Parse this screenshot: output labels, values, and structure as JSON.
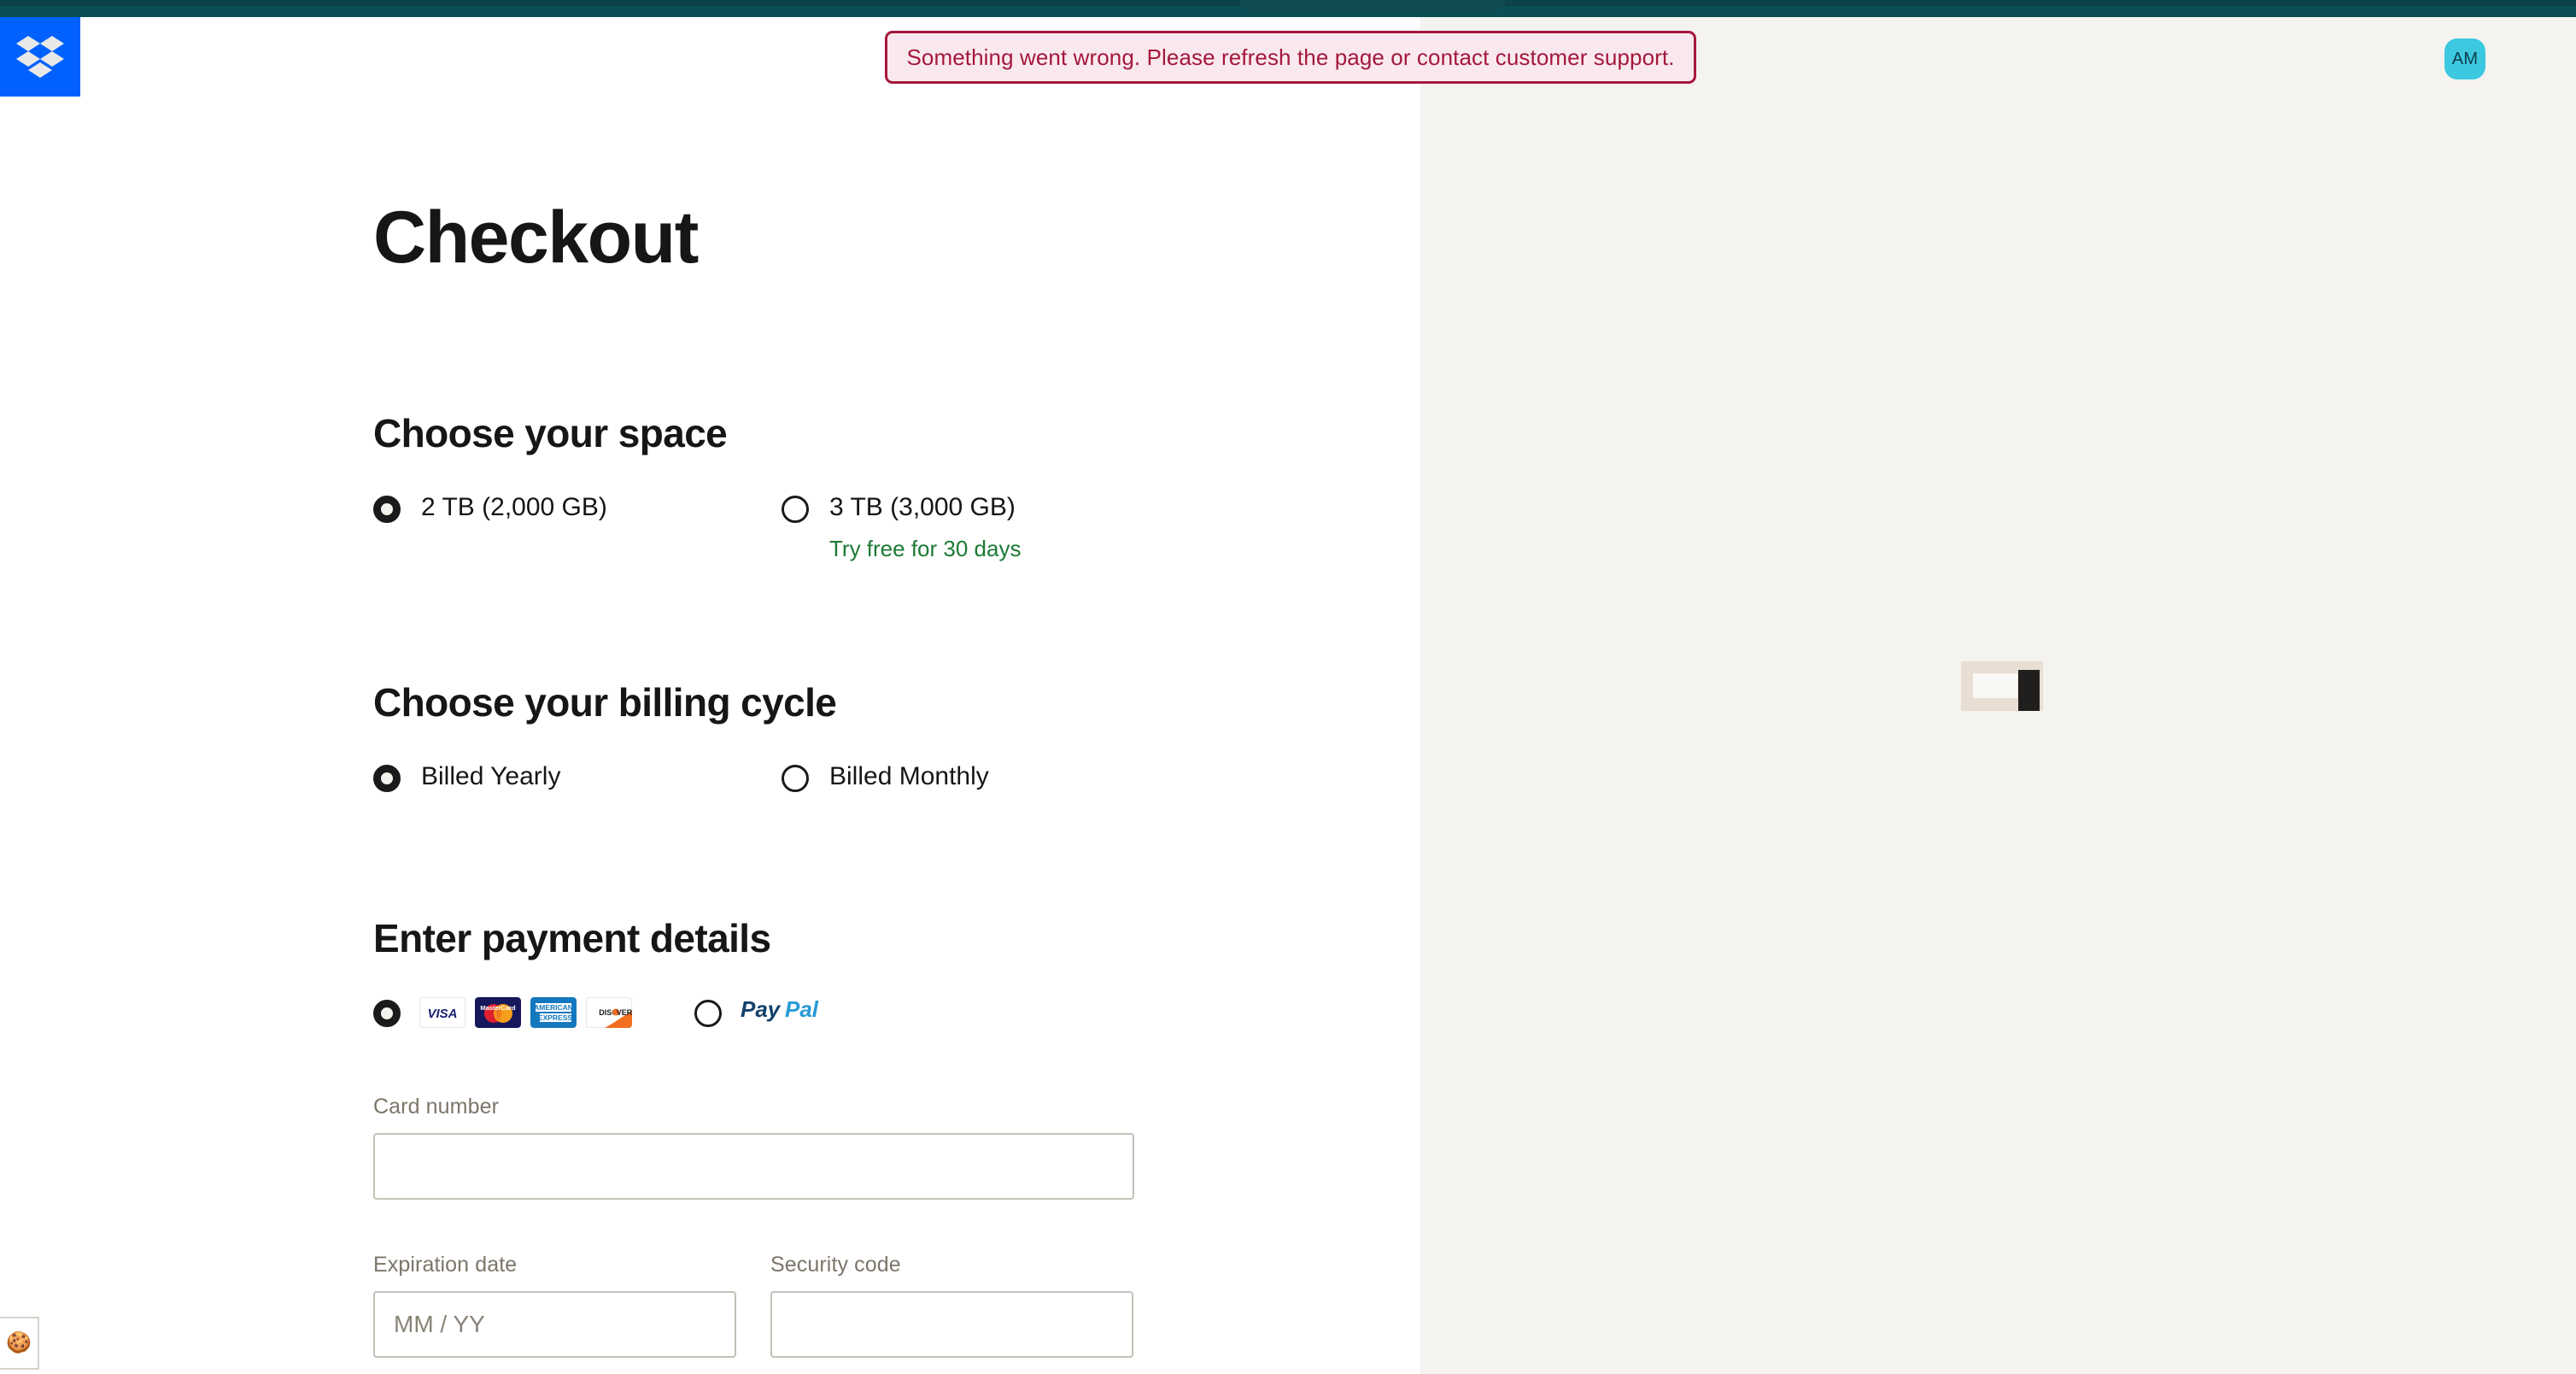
{
  "browser": {
    "tab_strip": "browser-chrome"
  },
  "brand": {
    "logo_name": "dropbox-logo",
    "logo_bg": "#0061fe"
  },
  "alert": {
    "message": "Something went wrong. Please refresh the page or contact customer support.",
    "border_color": "#a5173d",
    "background_color": "#f9e9ee"
  },
  "account": {
    "avatar_initials": "AM",
    "avatar_color": "#3cc8e0"
  },
  "page": {
    "title": "Checkout"
  },
  "space": {
    "heading": "Choose your space",
    "options": [
      {
        "label": "2 TB (2,000 GB)",
        "selected": true,
        "sub": ""
      },
      {
        "label": "3 TB (3,000 GB)",
        "selected": false,
        "sub": "Try free for 30 days"
      }
    ],
    "trial_color": "#1c7a33"
  },
  "billing": {
    "heading": "Choose your billing cycle",
    "options": [
      {
        "label": "Billed Yearly",
        "selected": true
      },
      {
        "label": "Billed Monthly",
        "selected": false
      }
    ]
  },
  "payment": {
    "heading": "Enter payment details",
    "method_card_selected": true,
    "method_paypal_selected": false,
    "card_brands": [
      "visa-logo",
      "mastercard-logo",
      "amex-logo",
      "discover-logo"
    ],
    "paypal_label": "PayPal",
    "fields": {
      "card_number_label": "Card number",
      "card_number_value": "",
      "card_number_placeholder": "",
      "expiration_label": "Expiration date",
      "expiration_value": "",
      "expiration_placeholder": "MM / YY",
      "security_label": "Security code",
      "security_value": "",
      "security_placeholder": ""
    }
  },
  "cookie": {
    "glyph": "🍪",
    "name": "cookie-preferences"
  }
}
